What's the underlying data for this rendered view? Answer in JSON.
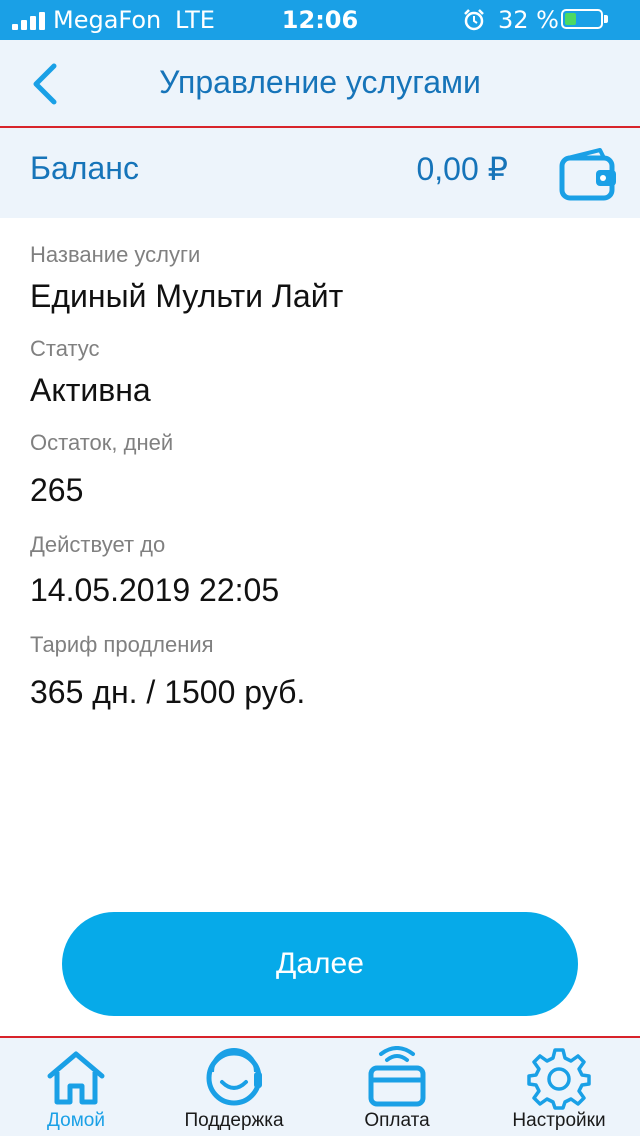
{
  "status_bar": {
    "carrier": "MegaFon",
    "network": "LTE",
    "time": "12:06",
    "battery_percent": "32 %",
    "battery_level": 0.32,
    "icons": [
      "signal-icon",
      "alarm-icon",
      "battery-icon"
    ]
  },
  "nav": {
    "title": "Управление услугами",
    "back_icon": "chevron-left-icon"
  },
  "balance": {
    "label": "Баланс",
    "amount": "0,00 ₽",
    "icon": "wallet-icon"
  },
  "service": {
    "name_label": "Название услуги",
    "name_value": "Единый Мульти Лайт",
    "status_label": "Статус",
    "status_value": "Активна",
    "days_left_label": "Остаток, дней",
    "days_left_value": "265",
    "valid_until_label": "Действует до",
    "valid_until_value": "14.05.2019 22:05",
    "renewal_label": "Тариф продления",
    "renewal_value": "365 дн. / 1500 руб."
  },
  "next_button": "Далее",
  "tabbar": {
    "items": [
      {
        "label": "Домой",
        "icon": "home-icon",
        "active": true
      },
      {
        "label": "Поддержка",
        "icon": "support-icon",
        "active": false
      },
      {
        "label": "Оплата",
        "icon": "payment-card-icon",
        "active": false
      },
      {
        "label": "Настройки",
        "icon": "gear-icon",
        "active": false
      }
    ]
  },
  "colors": {
    "accent": "#1aa0e6",
    "button": "#06aae9",
    "header_bg": "#edf4fb",
    "divider_red": "#d8232a",
    "title_blue": "#1674b9"
  }
}
